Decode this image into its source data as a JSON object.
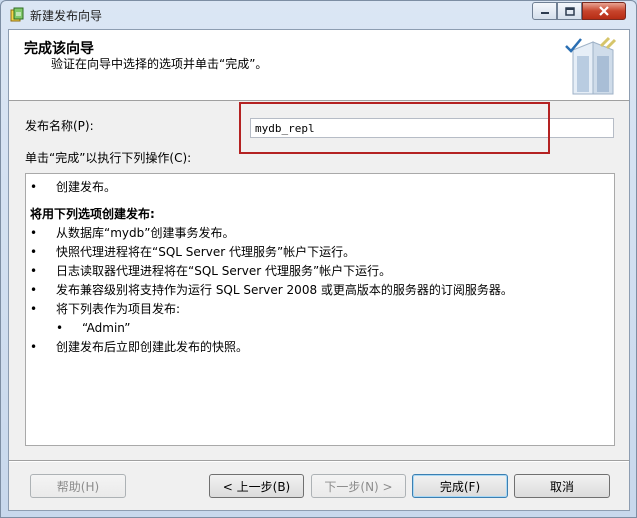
{
  "window": {
    "title": "新建发布向导",
    "icon": "wizard-app-icon",
    "controls": [
      "minimize",
      "maximize",
      "close"
    ]
  },
  "header": {
    "title": "完成该向导",
    "subtitle": "验证在向导中选择的选项并单击“完成”。"
  },
  "form": {
    "name_label": "发布名称(P):",
    "name_value": "mydb_repl",
    "actions_label": "单击“完成”以执行下列操作(C):"
  },
  "actions": {
    "top_items": [
      "创建发布。"
    ],
    "section_title": "将用下列选项创建发布:",
    "items": [
      "从数据库“mydb”创建事务发布。",
      "快照代理进程将在“SQL Server 代理服务”帐户下运行。",
      "日志读取器代理进程将在“SQL Server 代理服务”帐户下运行。",
      "发布兼容级别将支持作为运行 SQL Server 2008 或更高版本的服务器的订阅服务器。",
      "将下列表作为项目发布:"
    ],
    "sub_items": [
      "“Admin”"
    ],
    "final_items": [
      "创建发布后立即创建此发布的快照。"
    ],
    "bullet": "•"
  },
  "buttons": {
    "help": "帮助(H)",
    "back": "< 上一步(B)",
    "next": "下一步(N) >",
    "finish": "完成(F)",
    "cancel": "取消"
  },
  "colors": {
    "highlight_border": "#b42222",
    "close_button": "#c7442c"
  }
}
